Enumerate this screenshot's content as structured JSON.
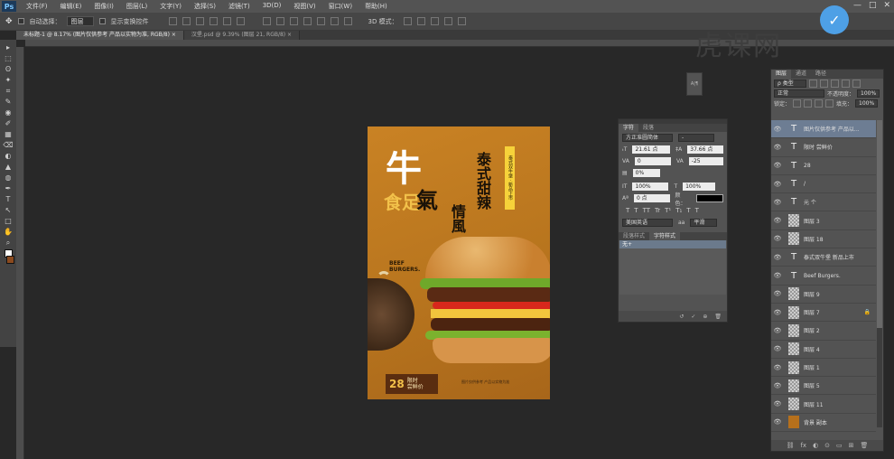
{
  "menubar": {
    "logo": "Ps",
    "items": [
      "文件(F)",
      "编辑(E)",
      "图像(I)",
      "图层(L)",
      "文字(Y)",
      "选择(S)",
      "滤镜(T)",
      "3D(D)",
      "视图(V)",
      "窗口(W)",
      "帮助(H)"
    ],
    "window_controls": [
      "—",
      "□",
      "✕"
    ]
  },
  "options_bar": {
    "auto_select_label": "自动选择：",
    "auto_select_value": "图层",
    "show_transform_label": "显示变换控件",
    "mode_3d_label": "3D 模式："
  },
  "tabs": [
    {
      "label": "未标题-1 @ 8.17% (图片仅供参考 产品以实物为准, RGB/8) ×",
      "active": true
    },
    {
      "label": "汉堡.psd @ 9.39% (图层 21, RGB/8) ×",
      "active": false
    }
  ],
  "tools": [
    "▸",
    "⬚",
    "ʘ",
    "✦",
    "⌗",
    "✎",
    "◉",
    "✐",
    "▦",
    "⌫",
    "◐",
    "▲",
    "◍",
    "✒",
    "T",
    "↖",
    "□",
    "✋",
    "⌕"
  ],
  "watermark": {
    "text": "虎课网",
    "badge": "✓"
  },
  "poster": {
    "big_char": "牛",
    "yellow_text": "食足",
    "qi_char": "氣",
    "vert_1": "泰式甜辣",
    "vert_2": "情風",
    "tag": "泰式双牛堡 · 新品上市",
    "beef": "BEEF\nBURGERS.",
    "price": "28",
    "price_text": "限时\n尝鲜价",
    "fine_print": "图片仅供参考 产品以实物为准"
  },
  "character_panel": {
    "tabs": [
      "字符",
      "段落"
    ],
    "font_family": "方正准圆简体",
    "font_style": "-",
    "font_size": "21.61 点",
    "leading": "37.66 点",
    "kerning": "0",
    "tracking": "-25",
    "scale_pct": "0%",
    "vscale": "100%",
    "hscale": "100%",
    "baseline": "0 点",
    "color_label": "颜色：",
    "glyph_buttons": [
      "T",
      "T",
      "TT",
      "Tr",
      "T¹",
      "T₁",
      "T",
      "T"
    ],
    "language": "美国英语",
    "antialias": "平滑",
    "sub_tabs": [
      "段落样式",
      "字符样式"
    ],
    "list_item": "无+",
    "bottom_icons": [
      "↺",
      "✓",
      "⊕",
      "🗑"
    ]
  },
  "mini_panel": {
    "label": "A|¶"
  },
  "layers_panel": {
    "tabs": [
      "图层",
      "通道",
      "路径"
    ],
    "filter_kind": "ρ 类型",
    "blend_mode": "正常",
    "opacity_label": "不透明度：",
    "opacity": "100%",
    "lock_label": "锁定：",
    "fill_label": "填充：",
    "fill": "100%",
    "layers": [
      {
        "type": "text",
        "name": "图片仅供参考 产品以...",
        "selected": true
      },
      {
        "type": "text",
        "name": "限时 尝鲜价",
        "selected": false
      },
      {
        "type": "text",
        "name": "28",
        "selected": false
      },
      {
        "type": "text",
        "name": "/",
        "selected": false
      },
      {
        "type": "text",
        "name": "元 个",
        "selected": false
      },
      {
        "type": "image",
        "name": "图层 3",
        "selected": false
      },
      {
        "type": "image",
        "name": "图层 18",
        "selected": false
      },
      {
        "type": "text",
        "name": "泰式双牛堡 新品上市",
        "selected": false
      },
      {
        "type": "text",
        "name": "Beef Burgers.",
        "selected": false
      },
      {
        "type": "image",
        "name": "图层 9",
        "selected": false
      },
      {
        "type": "image",
        "name": "图层 7",
        "selected": false,
        "locked": true
      },
      {
        "type": "image",
        "name": "图层 2",
        "selected": false
      },
      {
        "type": "image",
        "name": "图层 4",
        "selected": false
      },
      {
        "type": "image",
        "name": "图层 1",
        "selected": false
      },
      {
        "type": "image",
        "name": "图层 5",
        "selected": false
      },
      {
        "type": "image",
        "name": "图层 11",
        "selected": false
      },
      {
        "type": "brown",
        "name": "背景 副本",
        "selected": false
      }
    ],
    "bottom_icons": [
      "⛓",
      "fx",
      "◐",
      "⊙",
      "▭",
      "⊞",
      "🗑"
    ]
  }
}
